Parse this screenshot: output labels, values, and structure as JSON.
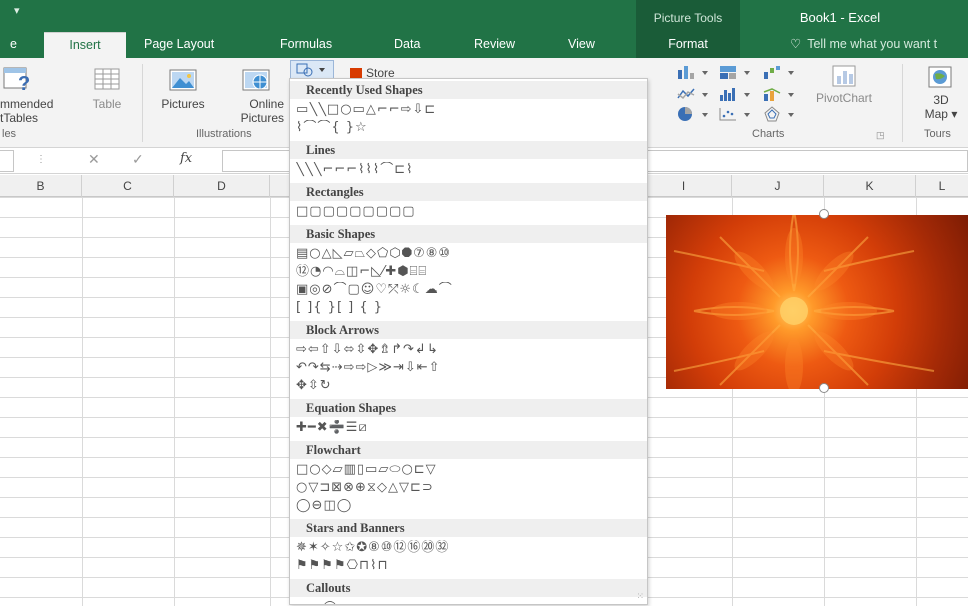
{
  "titlebar": {
    "qat": "▾",
    "context_group": "Picture Tools",
    "app_title": "Book1 - Excel"
  },
  "tabs": [
    {
      "label": "e"
    },
    {
      "label": "Insert"
    },
    {
      "label": "Page Layout"
    },
    {
      "label": "Formulas"
    },
    {
      "label": "Data"
    },
    {
      "label": "Review"
    },
    {
      "label": "View"
    },
    {
      "label": "Format"
    }
  ],
  "tell_me": "Tell me what you want t",
  "ribbon": {
    "recommended_line1": "mmended",
    "recommended_line2": "tTables",
    "table": "Table",
    "pictures": "Pictures",
    "online_line1": "Online",
    "online_line2": "Pictures",
    "store": "Store",
    "pivotchart": "PivotChart",
    "map_line1": "3D",
    "map_line2": "Map ▾",
    "groups": {
      "tables": "les",
      "illustrations": "Illustrations",
      "charts": "Charts",
      "tours": "Tours"
    }
  },
  "formula_bar": {
    "cancel": "✕",
    "enter": "✓",
    "fx": "fx",
    "value": ""
  },
  "columns": [
    "B",
    "C",
    "D",
    "I",
    "J",
    "K",
    "L"
  ],
  "shapes_gallery": {
    "categories": [
      {
        "title": "Recently Used Shapes",
        "rows": [
          "▭╲╲□○▭△⌐⌐⇨⇩⊏",
          "⌇⌒⌒{ }☆"
        ]
      },
      {
        "title": "Lines",
        "rows": [
          "╲╲╲⌐⌐⌐⌇⌇⌇⌒⊏⌇"
        ]
      },
      {
        "title": "Rectangles",
        "rows": [
          "□▢▢▢▢▢▢▢▢"
        ]
      },
      {
        "title": "Basic Shapes",
        "rows": [
          "▤○△◺▱⏢◇⬠⬡⯃⑦⑧⑩",
          "⑫◔◠⌓◫⌐◺⁄✚⬢⌸⌸",
          "▣◎⊘⌒▢☺♡⤱☼☾☁⌒",
          "[ ]{ }[ ] { }"
        ]
      },
      {
        "title": "Block Arrows",
        "rows": [
          "⇨⇦⇧⇩⬄⇳✥⇯↱↷↲↳",
          "↶↷⇆⇢⇨⇨▷≫⇥⇩⇤⇧",
          "✥⇳↻"
        ]
      },
      {
        "title": "Equation Shapes",
        "rows": [
          "✚━✖➗☰⧄"
        ]
      },
      {
        "title": "Flowchart",
        "rows": [
          "□○◇▱▥▯▭▱⬭○⊏▽",
          "○▽⊐⊠⊗⊕⧖◇△▽⊏⊃",
          "◯⊖◫◯"
        ]
      },
      {
        "title": "Stars and Banners",
        "rows": [
          "✵✶✧☆✩✪⑧⑩⑫⑯⑳㉜",
          "⚑⚑⚑⚑⎔⊓⌇⊓"
        ]
      },
      {
        "title": "Callouts",
        "rows": [
          "▭▭◯☁▭▭▭▭▭▭▭▭",
          "▭▭▭▭"
        ]
      }
    ]
  }
}
